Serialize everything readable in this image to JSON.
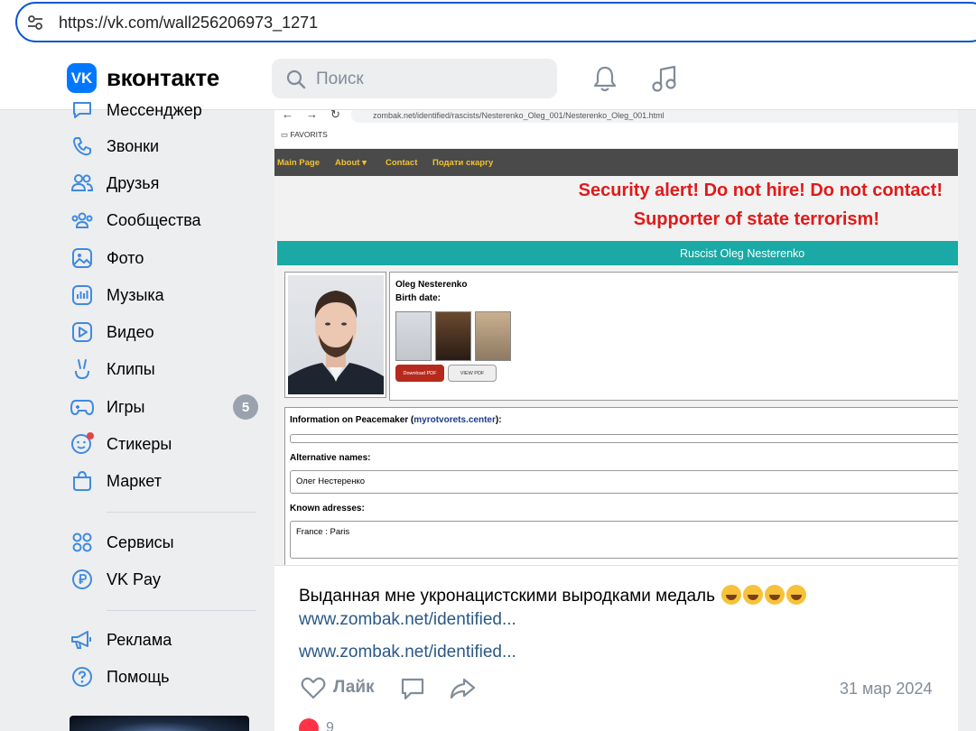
{
  "browser": {
    "url": "https://vk.com/wall256206973_1271",
    "site_info_icon": "tune-icon"
  },
  "header": {
    "logo_icon": "vk-logo-icon",
    "brand": "вконтакте",
    "search_placeholder": "Поиск",
    "notifications_icon": "bell-icon",
    "music_icon": "music-note-icon",
    "accent_color": "#0077ff"
  },
  "sidebar": {
    "items": [
      {
        "label": "Мессенджер",
        "icon": "chat-bubble-icon"
      },
      {
        "label": "Звонки",
        "icon": "phone-icon"
      },
      {
        "label": "Друзья",
        "icon": "friends-icon"
      },
      {
        "label": "Сообщества",
        "icon": "communities-icon"
      },
      {
        "label": "Фото",
        "icon": "photo-icon"
      },
      {
        "label": "Музыка",
        "icon": "music-icon"
      },
      {
        "label": "Видео",
        "icon": "video-icon"
      },
      {
        "label": "Клипы",
        "icon": "clips-icon"
      },
      {
        "label": "Игры",
        "icon": "gamepad-icon",
        "badge": "5"
      },
      {
        "label": "Стикеры",
        "icon": "sticker-icon"
      },
      {
        "label": "Маркет",
        "icon": "shopping-bag-icon"
      },
      {
        "label": "Сервисы",
        "icon": "services-grid-icon"
      },
      {
        "label": "VK Pay",
        "icon": "ruble-icon"
      },
      {
        "label": "Реклама",
        "icon": "megaphone-icon"
      },
      {
        "label": "Помощь",
        "icon": "help-icon"
      }
    ]
  },
  "post": {
    "screenshot": {
      "url": "zombak.net/identified/rascists/Nesterenko_Oleg_001/Nesterenko_Oleg_001.html",
      "favorites": "FAVORITS",
      "menu": [
        "Main Page",
        "About ▾",
        "Contact",
        "Подати скаргу"
      ],
      "alert_line1": "Security alert! Do not hire! Do not contact!",
      "alert_line2": "Supporter of state terrorism!",
      "banner": "Ruscist Oleg Nesterenko",
      "name": "Oleg Nesterenko",
      "birth_label": "Birth date:",
      "download_btn": "Download PDF",
      "view_btn": "VIEW PDF",
      "info_prefix": "Information on Peacemaker (",
      "info_link": "myrotvorets.center",
      "info_suffix": "):",
      "alt_names_label": "Alternative names:",
      "alt_name": "Олег Нестеренко",
      "addresses_label": "Known adresses:",
      "address": "France : Paris",
      "alert_color": "#e11a1a",
      "banner_color": "#1aa9a5"
    },
    "text": "Выданная мне укронацистскими выродками медаль",
    "link1": "www.zombak.net/identified...",
    "link2": "www.zombak.net/identified...",
    "like_label": "Лайк",
    "date": "31 мар 2024",
    "reactions_count": "9"
  }
}
